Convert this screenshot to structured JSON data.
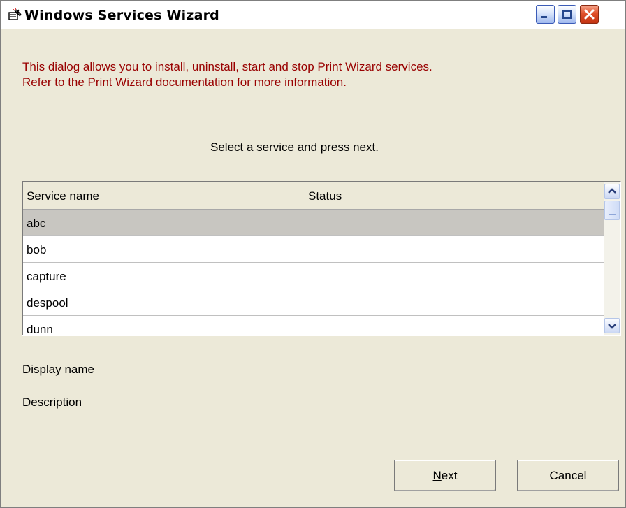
{
  "window": {
    "title": "Windows Services Wizard"
  },
  "titlebar_buttons": {
    "minimize": "minimize-icon",
    "maximize": "maximize-icon",
    "close": "close-icon"
  },
  "intro": {
    "line1": "This dialog allows you to install, uninstall, start and stop Print Wizard services.",
    "line2": "Refer to the Print Wizard documentation for more information."
  },
  "instruction": "Select a service and press next.",
  "services_list": {
    "columns": [
      "Service name",
      "Status"
    ],
    "rows": [
      {
        "name": "abc",
        "status": "",
        "selected": true
      },
      {
        "name": "bob",
        "status": ""
      },
      {
        "name": "capture",
        "status": ""
      },
      {
        "name": "despool",
        "status": ""
      },
      {
        "name": "dunn",
        "status": ""
      }
    ]
  },
  "details": {
    "display_name_label": "Display name",
    "description_label": "Description"
  },
  "buttons": {
    "next_mnemonic": "N",
    "next_rest": "ext",
    "cancel": "Cancel"
  },
  "colors": {
    "intro_text": "#990000",
    "dialog_bg": "#ece9d8",
    "selected_row": "#c8c6c1"
  }
}
